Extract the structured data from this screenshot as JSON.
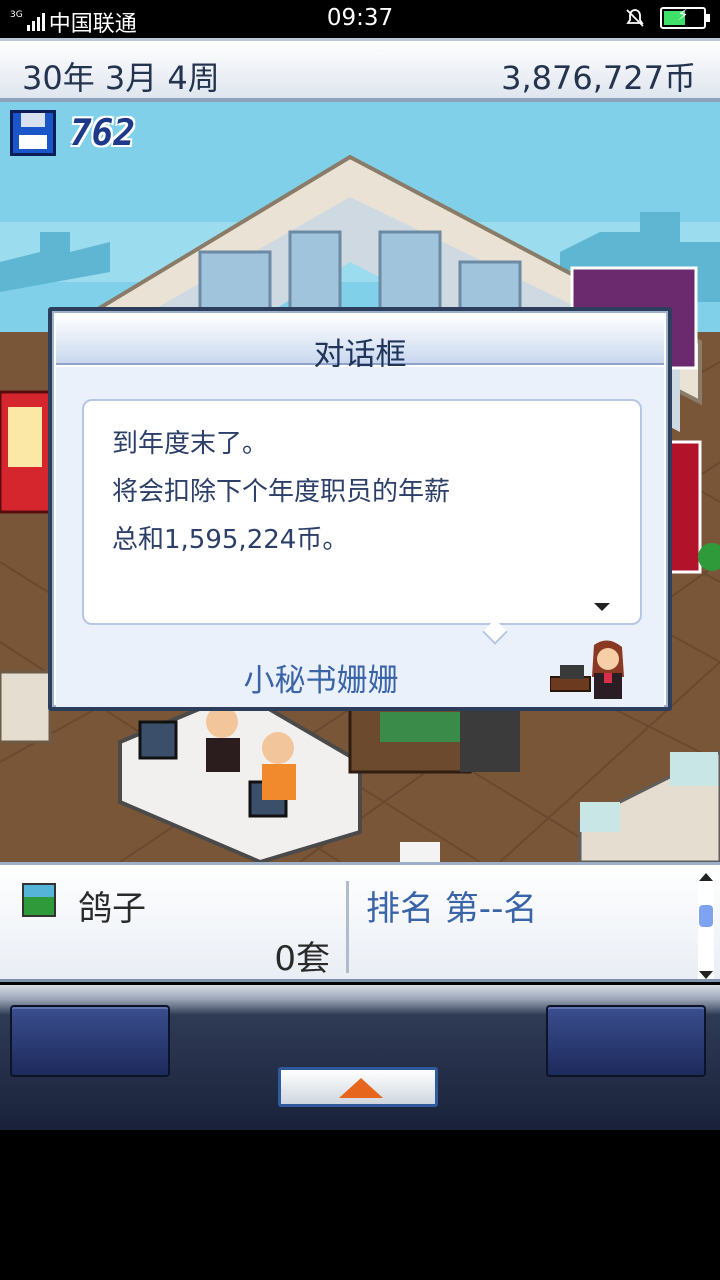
{
  "status_bar": {
    "network_small": "3G",
    "carrier": "中国联通",
    "time": "09:37"
  },
  "top_bar": {
    "date": "30年 3月 4周",
    "money": "3,876,727币"
  },
  "save_counter": {
    "value": "762"
  },
  "dialog": {
    "title": "对话框",
    "lines": [
      "到年度末了。",
      "将会扣除下个年度职员的年薪",
      "总和1,595,224币。"
    ],
    "speaker": "小秘书姗姗"
  },
  "info_panel": {
    "product_name": "鸽子",
    "product_count": "0套",
    "rank": "排名 第--名"
  },
  "colors": {
    "title_text": "#21355a",
    "accent_blue": "#3a64a8",
    "up_arrow": "#e5661c"
  }
}
